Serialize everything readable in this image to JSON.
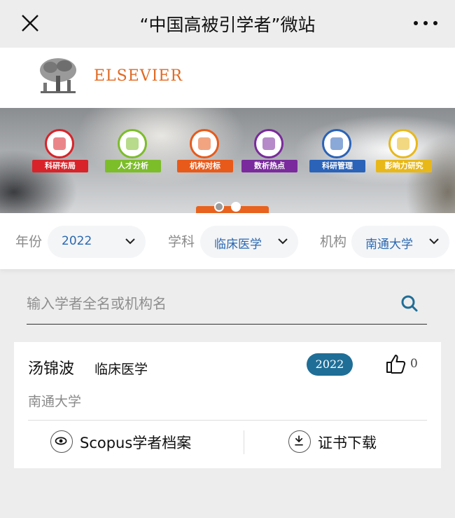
{
  "topbar": {
    "title": "“中国高被引学者”微站",
    "close_icon": "close-icon",
    "more_icon": "more-icon"
  },
  "logo": {
    "brand": "ELSEVIER"
  },
  "banner": {
    "tiles": [
      {
        "label": "科研布局",
        "color": "#d8232a"
      },
      {
        "label": "人才分析",
        "color": "#7cbd2a"
      },
      {
        "label": "机构对标",
        "color": "#e85a1a"
      },
      {
        "label": "数析热点",
        "color": "#7a2a9c"
      },
      {
        "label": "科研管理",
        "color": "#2a63b8"
      },
      {
        "label": "影响力研究",
        "color": "#e8b81a"
      }
    ],
    "active_dot": 2
  },
  "filters": {
    "year_label": "年份",
    "year_value": "2022",
    "subject_label": "学科",
    "subject_value": "临床医学",
    "org_label": "机构",
    "org_value": "南通大学"
  },
  "search": {
    "placeholder": "输入学者全名或机构名",
    "value": ""
  },
  "result": {
    "name": "汤锦波",
    "field": "临床医学",
    "year": "2022",
    "likes": "0",
    "institution": "南通大学",
    "scopus_label": "Scopus学者档案",
    "download_label": "证书下载"
  }
}
